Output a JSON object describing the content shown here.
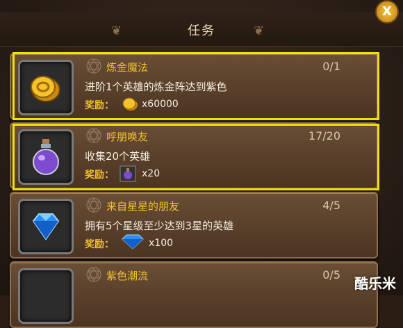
{
  "header": {
    "title": "任务",
    "close_label": "X"
  },
  "reward_label": "奖励：",
  "tasks": [
    {
      "title": "炼金魔法",
      "progress": "0/1",
      "description": "进阶1个英雄的炼金阵达到紫色",
      "reward_icon": "gold-coin-icon",
      "reward_amount": "x60000"
    },
    {
      "title": "呼朋唤友",
      "progress": "17/20",
      "description": "收集20个英雄",
      "reward_icon": "potion-icon",
      "reward_amount": "x20"
    },
    {
      "title": "来自星星的朋友",
      "progress": "4/5",
      "description": "拥有5个星级至少达到3星的英雄",
      "reward_icon": "diamond-icon",
      "reward_amount": "x100"
    },
    {
      "title": "紫色潮流",
      "progress": "0/5",
      "description": "",
      "reward_icon": "",
      "reward_amount": ""
    }
  ],
  "watermark": "酷乐米",
  "colors": {
    "highlight": "#f2e000",
    "title_gold": "#f0c030"
  }
}
